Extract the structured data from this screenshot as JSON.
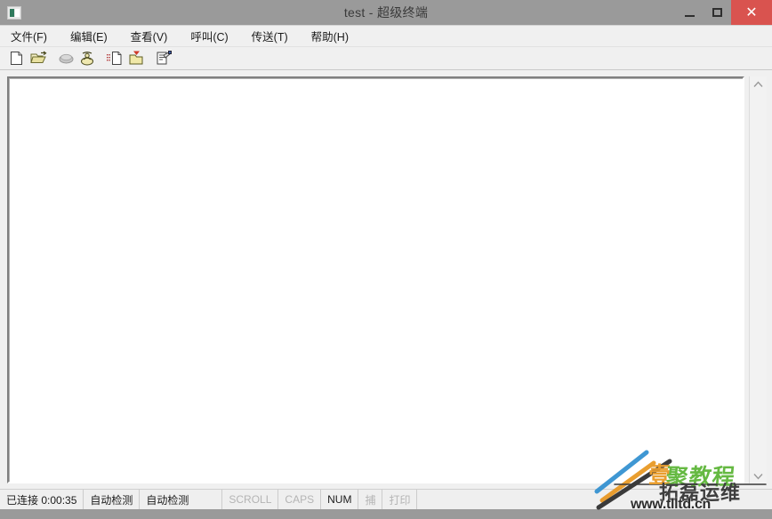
{
  "window": {
    "title": "test - 超级终端",
    "icon": "terminal-window-icon",
    "controls": {
      "minimize": "—",
      "maximize": "□",
      "close": "✕"
    },
    "close_color": "#d9534f",
    "titlebar_color": "#9a9a9a",
    "frame_color": "#9a9a9a"
  },
  "menubar": {
    "items": [
      {
        "label": "文件(F)",
        "name": "menu-file"
      },
      {
        "label": "编辑(E)",
        "name": "menu-edit"
      },
      {
        "label": "查看(V)",
        "name": "menu-view"
      },
      {
        "label": "呼叫(C)",
        "name": "menu-call"
      },
      {
        "label": "传送(T)",
        "name": "menu-transfer"
      },
      {
        "label": "帮助(H)",
        "name": "menu-help"
      }
    ]
  },
  "toolbar": {
    "buttons": [
      {
        "name": "new-connection-icon",
        "title": "新建连接",
        "enabled": true
      },
      {
        "name": "open-folder-icon",
        "title": "打开",
        "enabled": true
      },
      {
        "name": "disconnect-phone-icon",
        "title": "断开",
        "enabled": false
      },
      {
        "name": "connect-phone-icon",
        "title": "呼叫",
        "enabled": true
      },
      {
        "name": "send-file-icon",
        "title": "发送",
        "enabled": true
      },
      {
        "name": "receive-file-icon",
        "title": "接收",
        "enabled": true
      },
      {
        "name": "properties-icon",
        "title": "属性",
        "enabled": true
      }
    ]
  },
  "terminal": {
    "content": "",
    "background": "#ffffff"
  },
  "scrollbar": {
    "up_arrow": "▲",
    "down_arrow": "▼"
  },
  "statusbar": {
    "connection": "已连接 0:00:35",
    "detect_protocol": "自动检测",
    "detect_speed": "自动检测",
    "indicators": [
      {
        "label": "SCROLL",
        "active": false,
        "name": "status-scroll"
      },
      {
        "label": "CAPS",
        "active": false,
        "name": "status-caps"
      },
      {
        "label": "NUM",
        "active": true,
        "name": "status-num"
      },
      {
        "label": "捕",
        "active": false,
        "name": "status-capture"
      },
      {
        "label": "打印",
        "active": false,
        "name": "status-print"
      }
    ]
  },
  "watermark": {
    "url": "www.tlltd.cn",
    "brand_cn": "拓磊运维",
    "tagline_cn": "壹聚教程",
    "colors": {
      "blue": "#2f8fd0",
      "orange": "#e8961e",
      "green": "#58b432",
      "dark": "#303030"
    }
  }
}
